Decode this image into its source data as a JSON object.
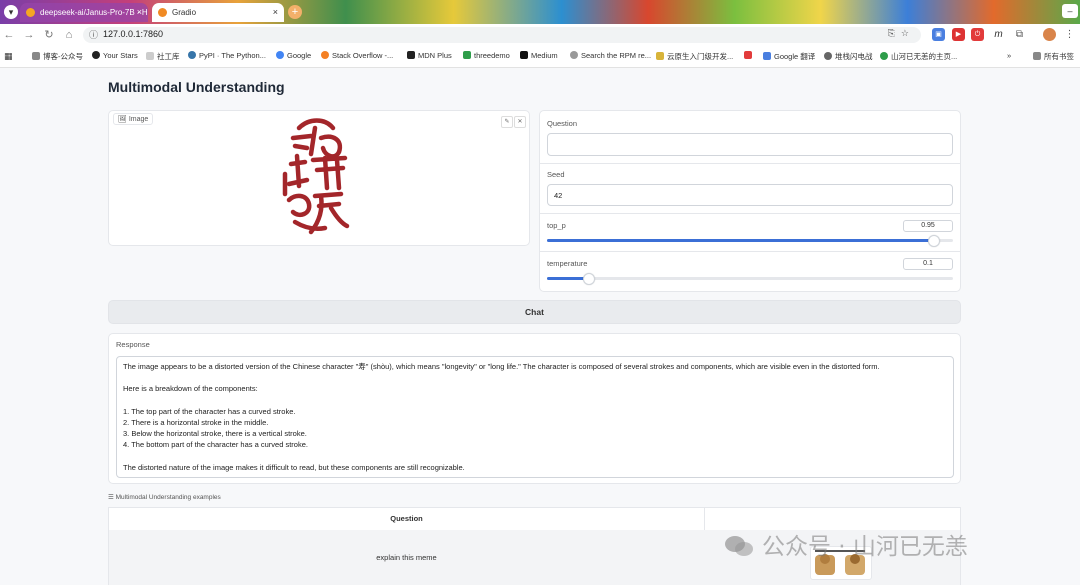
{
  "browser": {
    "tabs": [
      {
        "title": "deepseek-ai/Janus-Pro-7B · H",
        "close": "×"
      },
      {
        "title": "Gradio",
        "close": "×"
      }
    ],
    "new_tab": "+",
    "url": "127.0.0.1:7860",
    "bookmarks": [
      "博客-公众号",
      "Your Stars",
      "社工库",
      "PyPI · The Python...",
      "Google",
      "Stack Overflow -...",
      "MDN Plus",
      "threedemo",
      "Medium",
      "Search the RPM re...",
      "云原生入门级开发...",
      "Google 翻译",
      "堆栈闪电战",
      "山河已无恙的主页...",
      "»",
      "所有书签"
    ]
  },
  "app": {
    "title": "Multimodal Understanding",
    "image_label": "Image",
    "question": {
      "label": "Question",
      "value": ""
    },
    "seed": {
      "label": "Seed",
      "value": "42"
    },
    "top_p": {
      "label": "top_p",
      "value": "0.95",
      "fraction": 0.95
    },
    "temperature": {
      "label": "temperature",
      "value": "0.1",
      "fraction": 0.1
    },
    "chat_button": "Chat",
    "response": {
      "label": "Response",
      "text": "The image appears to be a distorted version of the Chinese character \"寿\" (shòu), which means \"longevity\" or \"long life.\" The character is composed of several strokes and components, which are visible even in the distorted form.\n\nHere is a breakdown of the components:\n\n1. The top part of the character has a curved stroke.\n2. There is a horizontal stroke in the middle.\n3. Below the horizontal stroke, there is a vertical stroke.\n4. The bottom part of the character has a curved stroke.\n\nThe distorted nature of the image makes it difficult to read, but these components are still recognizable."
    },
    "examples": {
      "label": "☰ Multimodal Understanding examples",
      "header": "Question",
      "rows": [
        {
          "question": "explain this meme"
        }
      ]
    }
  },
  "watermark": "公众号 · 山河已无恙",
  "colors": {
    "accent": "#3b6fd6",
    "seal": "#a3262a"
  }
}
